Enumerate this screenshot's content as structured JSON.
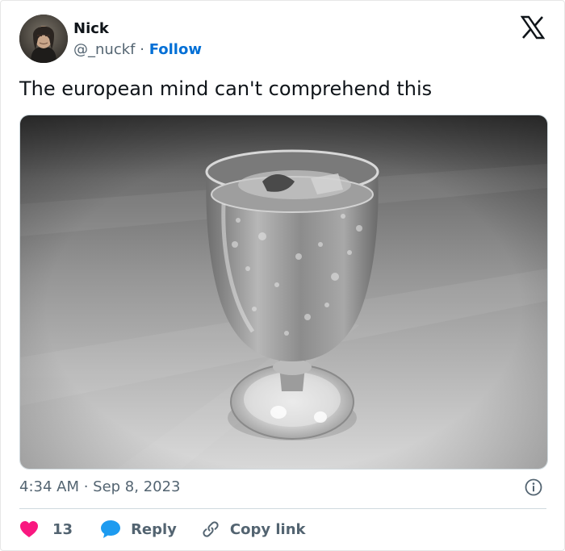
{
  "author": {
    "name": "Nick",
    "handle": "@_nuckf",
    "separator": "·",
    "follow_label": "Follow"
  },
  "tweet": {
    "text": "The european mind can't comprehend this",
    "timestamp": "4:34 AM · Sep 8, 2023"
  },
  "actions": {
    "like_count": "13",
    "reply_label": "Reply",
    "copy_label": "Copy link"
  },
  "colors": {
    "like": "#f91880",
    "reply": "#1d9bf0",
    "follow": "#006fd6",
    "secondary_text": "#536471"
  },
  "icons": {
    "brand": "x-logo-icon",
    "info": "info-icon",
    "like": "heart-icon",
    "reply": "speech-bubble-icon",
    "copy": "link-icon"
  }
}
